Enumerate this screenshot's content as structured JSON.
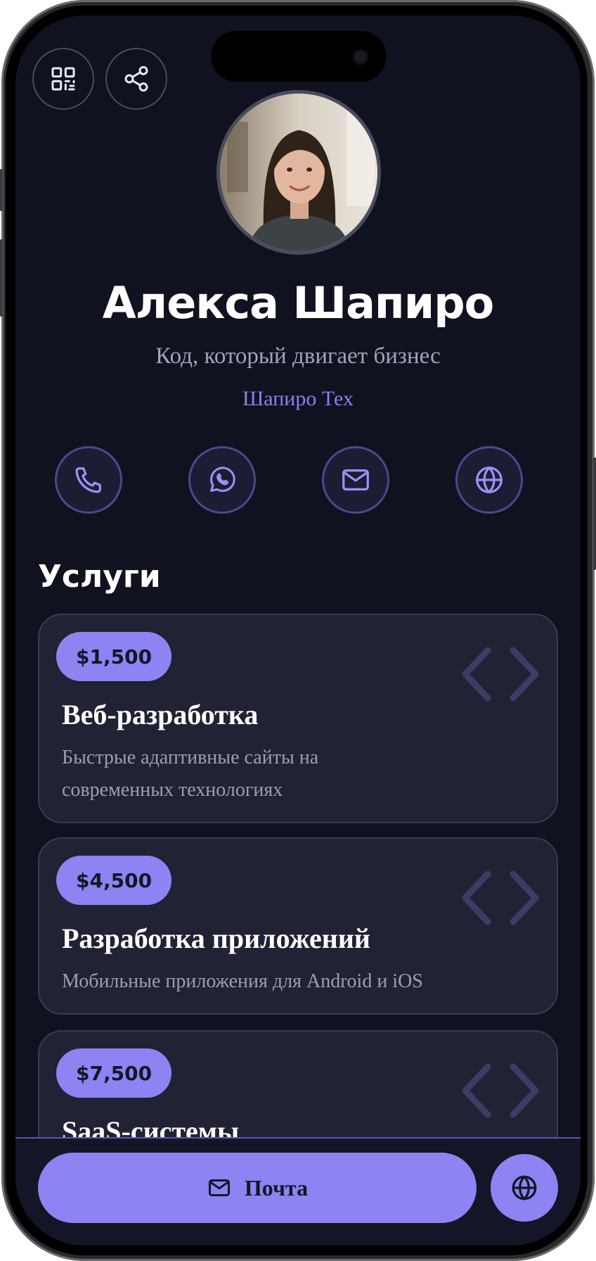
{
  "top_actions": [
    {
      "icon": "qr-code-icon"
    },
    {
      "icon": "share-icon"
    }
  ],
  "profile": {
    "name": "Алекса Шапиро",
    "tagline": "Код, который двигает бизнес",
    "company": "Шапиро Тех"
  },
  "contacts": [
    {
      "icon": "phone-icon"
    },
    {
      "icon": "whatsapp-icon"
    },
    {
      "icon": "mail-icon"
    },
    {
      "icon": "globe-icon"
    }
  ],
  "services": {
    "title": "Услуги",
    "items": [
      {
        "price": "$1,500",
        "title": "Веб-разработка",
        "description": "Быстрые адаптивные сайты на современных технологиях"
      },
      {
        "price": "$4,500",
        "title": "Разработка приложений",
        "description": "Мобильные приложения для Android и iOS"
      },
      {
        "price": "$7,500",
        "title": "SaaS-системы",
        "description": ""
      }
    ]
  },
  "bottom_bar": {
    "mail_label": "Почта",
    "mail_icon": "mail-icon",
    "web_icon": "globe-icon"
  },
  "colors": {
    "background": "#11121f",
    "accent": "#8c84f2",
    "card": "#212233",
    "company_text": "#8b7ff5"
  }
}
